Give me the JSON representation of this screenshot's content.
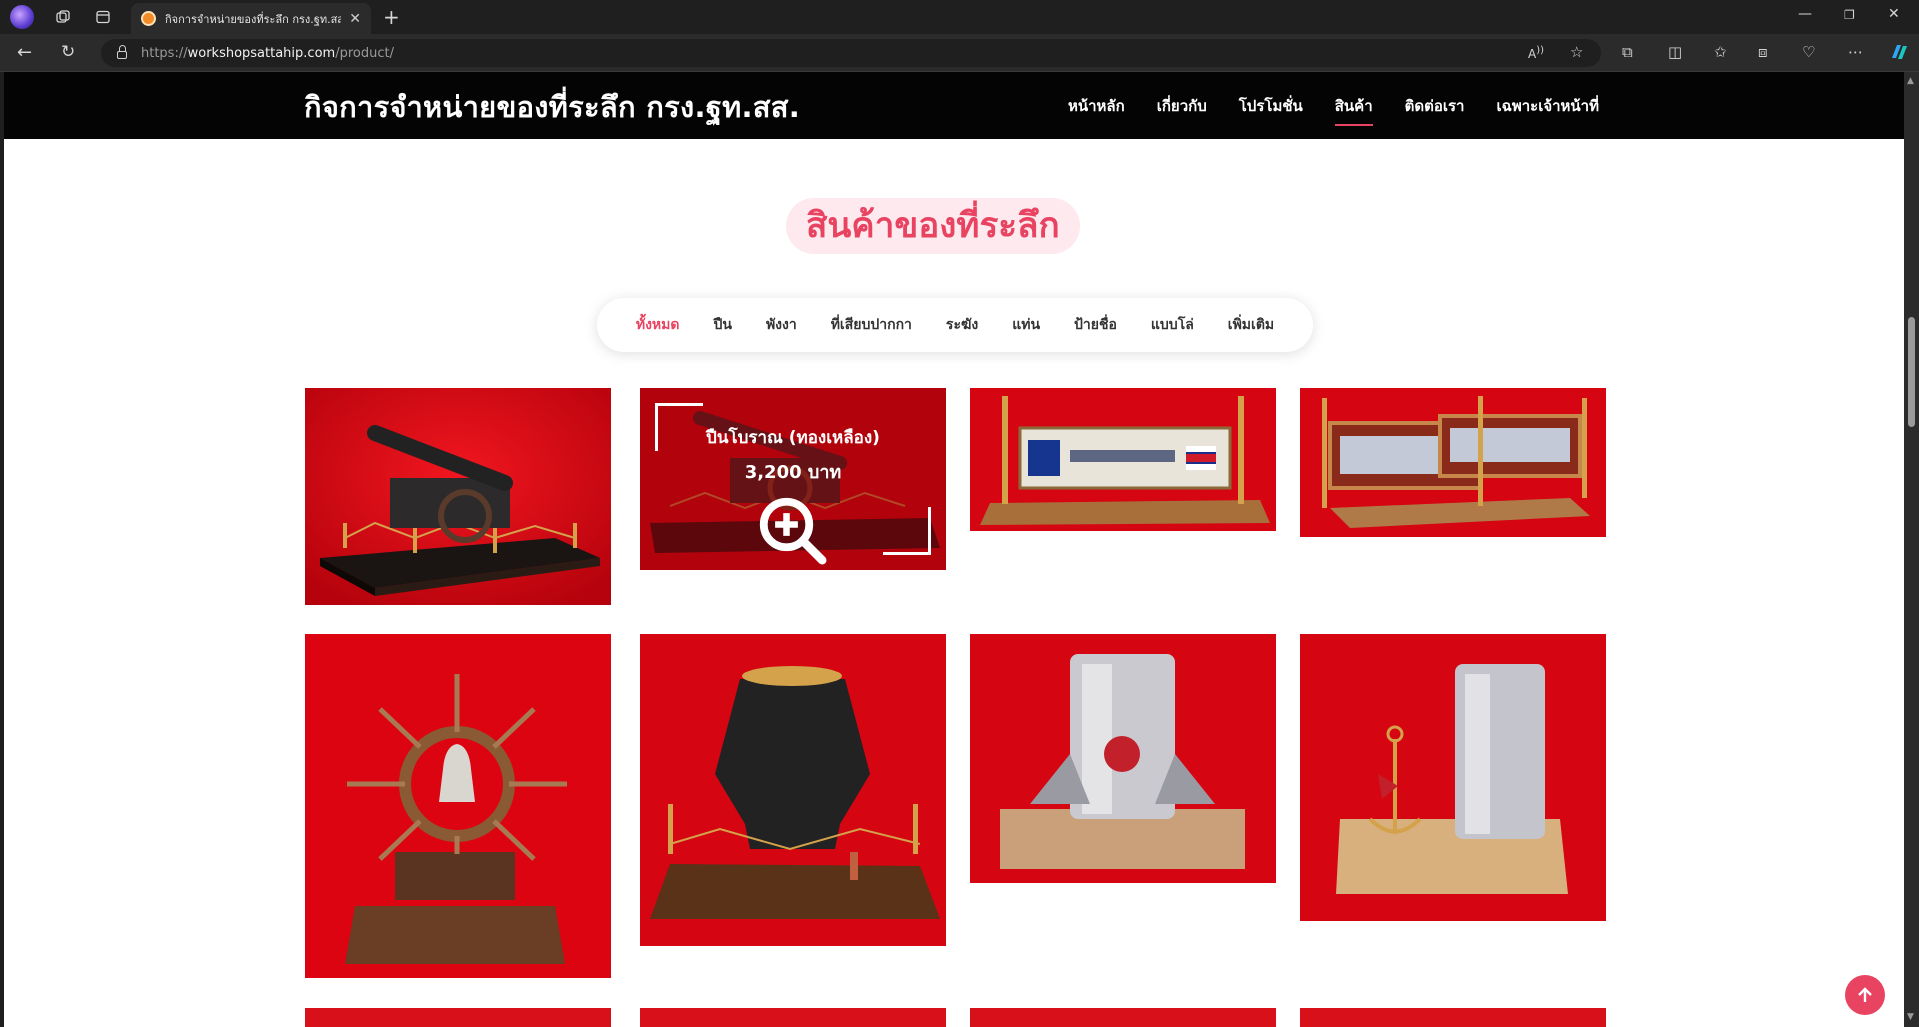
{
  "browser": {
    "tab_title": "กิจการจำหน่ายของที่ระลึก กรง.ฐท.สส.",
    "url_scheme": "https://",
    "url_host": "workshopsattahip.com",
    "url_path": "/product/"
  },
  "site": {
    "logo": "กิจการจำหน่ายของที่ระลึก กรง.ฐท.สส.",
    "nav": [
      {
        "label": "หน้าหลัก",
        "active": false
      },
      {
        "label": "เกี่ยวกับ",
        "active": false
      },
      {
        "label": "โปรโมชั่น",
        "active": false
      },
      {
        "label": "สินค้า",
        "active": true
      },
      {
        "label": "ติดต่อเรา",
        "active": false
      },
      {
        "label": "เฉพาะเจ้าหน้าที่",
        "active": false
      }
    ],
    "accent_color": "#e84361"
  },
  "section": {
    "title": "สินค้าของที่ระลึก"
  },
  "filters": [
    {
      "label": "ทั้งหมด",
      "active": true
    },
    {
      "label": "ปืน",
      "active": false
    },
    {
      "label": "พังงา",
      "active": false
    },
    {
      "label": "ที่เสียบปากกา",
      "active": false
    },
    {
      "label": "ระฆัง",
      "active": false
    },
    {
      "label": "แท่น",
      "active": false
    },
    {
      "label": "ป้ายชื่อ",
      "active": false
    },
    {
      "label": "แบบโล่",
      "active": false
    },
    {
      "label": "เพิ่มเติม",
      "active": false
    }
  ],
  "products": [
    {
      "image": "black-cannon-on-wood-base"
    },
    {
      "image": "antique-cannon",
      "hover_name": "ปืนโบราณ (ทองเหลือง)",
      "hover_price": "3,200 บาท",
      "hovered": true
    },
    {
      "image": "brass-name-plate-stand"
    },
    {
      "image": "double-name-plate-stand"
    },
    {
      "image": "ship-wheel-bell"
    },
    {
      "image": "black-pot-on-wood-base"
    },
    {
      "image": "steel-cup-with-emblem"
    },
    {
      "image": "steel-cup-with-anchor"
    }
  ],
  "icons": {
    "scroll_top": "arrow-up-icon",
    "zoom": "zoom-in-icon"
  }
}
